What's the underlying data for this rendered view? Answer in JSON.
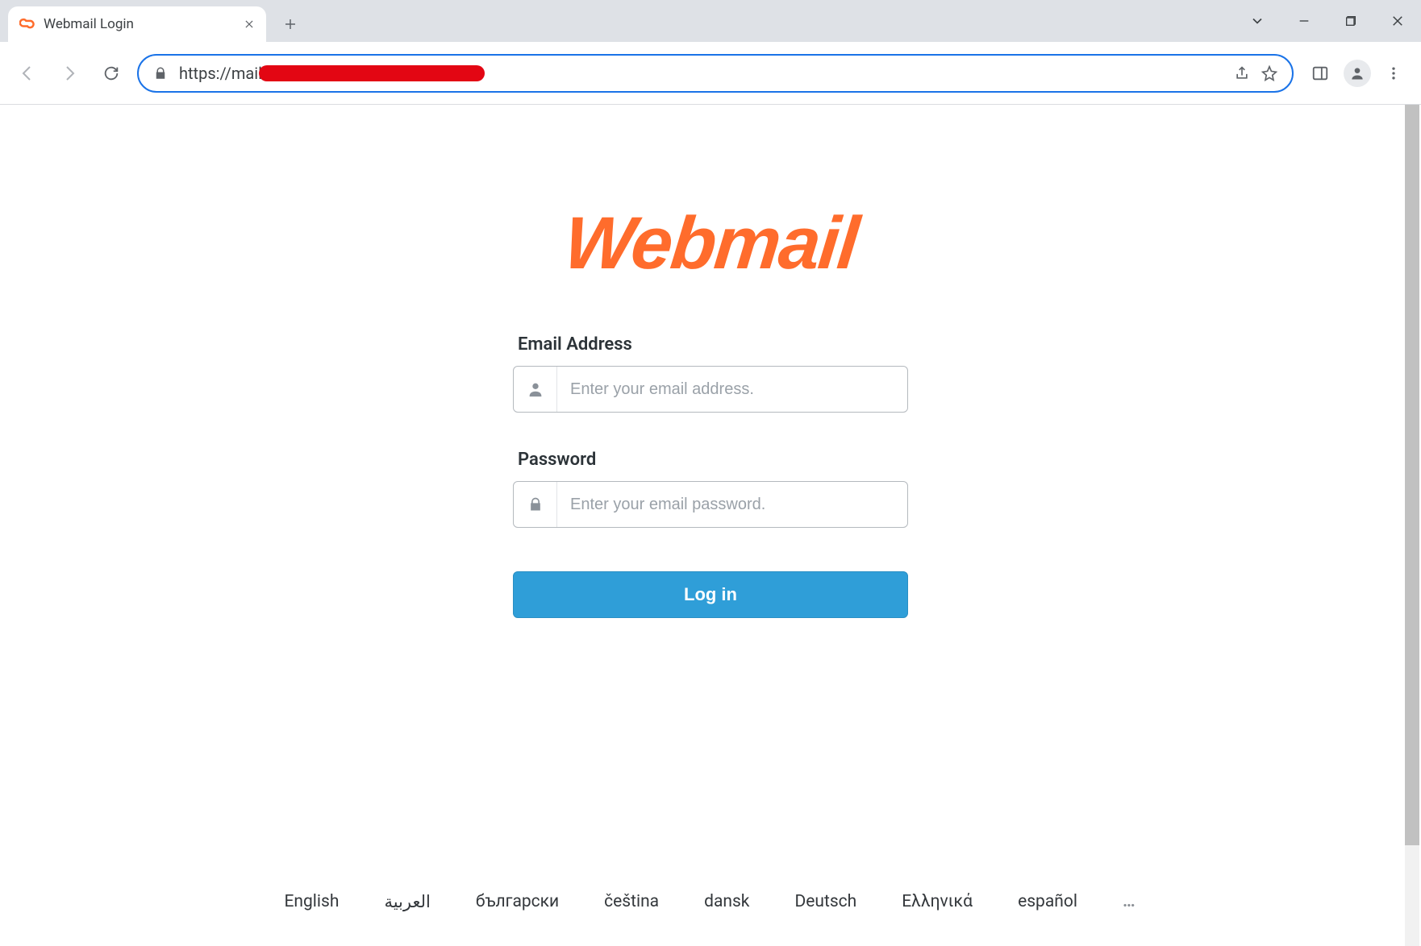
{
  "tab": {
    "title": "Webmail Login"
  },
  "address_bar": {
    "url_prefix": "https://mail"
  },
  "logo_text": "Webmail",
  "form": {
    "email": {
      "label": "Email Address",
      "placeholder": "Enter your email address.",
      "value": ""
    },
    "password": {
      "label": "Password",
      "placeholder": "Enter your email password.",
      "value": ""
    },
    "submit_label": "Log in"
  },
  "languages": [
    "English",
    "العربية",
    "български",
    "čeština",
    "dansk",
    "Deutsch",
    "Ελληνικά",
    "español"
  ],
  "languages_more": "…"
}
